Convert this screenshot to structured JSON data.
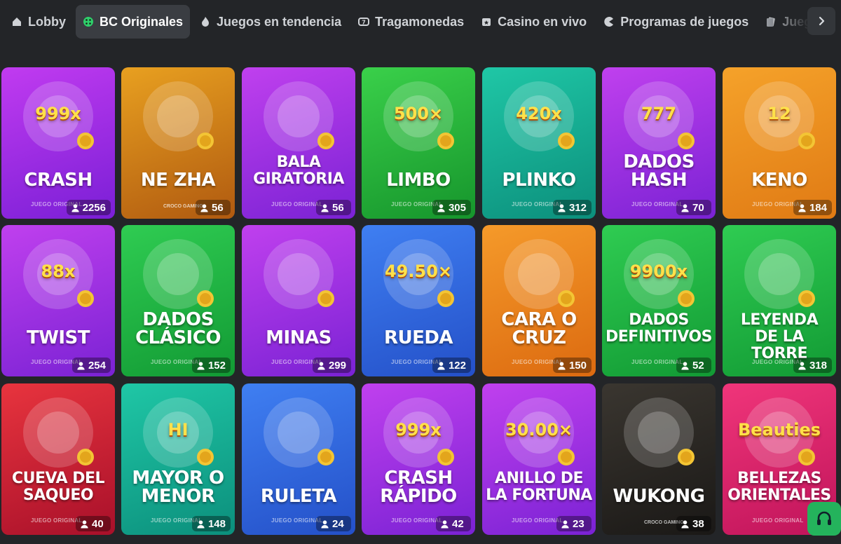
{
  "tabs": [
    {
      "label": "Lobby",
      "icon": "house-icon",
      "active": false
    },
    {
      "label": "BC Originales",
      "icon": "dice-icon",
      "active": true
    },
    {
      "label": "Juegos en tendencia",
      "icon": "flame-icon",
      "active": false
    },
    {
      "label": "Tragamonedas",
      "icon": "slot-icon",
      "active": false
    },
    {
      "label": "Casino en vivo",
      "icon": "live-icon",
      "active": false
    },
    {
      "label": "Programas de juegos",
      "icon": "pacman-icon",
      "active": false
    },
    {
      "label": "Jueg",
      "icon": "cards-icon",
      "active": false
    }
  ],
  "games": [
    {
      "lines": [
        "CRASH"
      ],
      "sub": "JUEGO ORIGINAL",
      "players": "2256",
      "colors": [
        "#c13bf0",
        "#7a1fd6"
      ]
    },
    {
      "lines": [
        "NE ZHA"
      ],
      "sub": "CROCO GAMING",
      "players": "56",
      "colors": [
        "#e8a020",
        "#b05a10"
      ]
    },
    {
      "lines": [
        "BALA",
        "GIRATORIA"
      ],
      "sub": "JUEGO ORIGINAL",
      "players": "56",
      "colors": [
        "#c040ee",
        "#7a22d4"
      ]
    },
    {
      "lines": [
        "LIMBO"
      ],
      "sub": "JUEGO ORIGINAL",
      "players": "305",
      "colors": [
        "#3ad04a",
        "#16952c"
      ]
    },
    {
      "lines": [
        "PLINKO"
      ],
      "sub": "JUEGO ORIGINAL",
      "players": "312",
      "colors": [
        "#1fc7a6",
        "#0c8f7c"
      ]
    },
    {
      "lines": [
        "DADOS",
        "HASH"
      ],
      "sub": "JUEGO ORIGINAL",
      "players": "70",
      "colors": [
        "#c040ee",
        "#7a22d4"
      ]
    },
    {
      "lines": [
        "KENO"
      ],
      "sub": "JUEGO ORIGINAL",
      "players": "184",
      "colors": [
        "#f5a22a",
        "#e07a14"
      ]
    },
    {
      "lines": [
        "TWIST"
      ],
      "sub": "JUEGO ORIGINAL",
      "players": "254",
      "colors": [
        "#c040ee",
        "#7a22d4"
      ]
    },
    {
      "lines": [
        "DADOS",
        "CLÁSICO"
      ],
      "sub": "JUEGO ORIGINAL",
      "players": "152",
      "colors": [
        "#2fcc52",
        "#129a34"
      ]
    },
    {
      "lines": [
        "MINAS"
      ],
      "sub": "JUEGO ORIGINAL",
      "players": "299",
      "colors": [
        "#c040ee",
        "#7a22d4"
      ]
    },
    {
      "lines": [
        "RUEDA"
      ],
      "sub": "JUEGO ORIGINAL",
      "players": "122",
      "colors": [
        "#3f7ff2",
        "#2450c8"
      ]
    },
    {
      "lines": [
        "CARA O",
        "CRUZ"
      ],
      "sub": "JUEGO ORIGINAL",
      "players": "150",
      "colors": [
        "#f59a2a",
        "#dc6a10"
      ]
    },
    {
      "lines": [
        "DADOS",
        "DEFINITIVOS"
      ],
      "sub": "JUEGO ORIGINAL",
      "players": "52",
      "colors": [
        "#2fcc52",
        "#129a34"
      ]
    },
    {
      "lines": [
        "LEYENDA",
        "DE LA TORRE"
      ],
      "sub": "JUEGO ORIGINAL",
      "players": "318",
      "colors": [
        "#2fcc52",
        "#129a34"
      ]
    },
    {
      "lines": [
        "CUEVA DEL",
        "SAQUEO"
      ],
      "sub": "JUEGO ORIGINAL",
      "players": "40",
      "colors": [
        "#e8343e",
        "#a8102a"
      ]
    },
    {
      "lines": [
        "MAYOR O",
        "MENOR"
      ],
      "sub": "JUEGO ORIGINAL",
      "players": "148",
      "colors": [
        "#1fc7a6",
        "#0c8f7c"
      ]
    },
    {
      "lines": [
        "RULETA"
      ],
      "sub": "JUEGO ORIGINAL",
      "players": "24",
      "colors": [
        "#3f7ff2",
        "#2450c8"
      ]
    },
    {
      "lines": [
        "CRASH",
        "RÁPIDO"
      ],
      "sub": "JUEGO ORIGINAL",
      "players": "42",
      "colors": [
        "#c040ee",
        "#7a22d4"
      ]
    },
    {
      "lines": [
        "ANILLO DE",
        "LA FORTUNA"
      ],
      "sub": "JUEGO ORIGINAL",
      "players": "23",
      "colors": [
        "#c040ee",
        "#7a22d4"
      ]
    },
    {
      "lines": [
        "WUKONG"
      ],
      "sub": "CROCO GAMING",
      "players": "38",
      "colors": [
        "#3a3630",
        "#1a1816"
      ]
    },
    {
      "lines": [
        "BELLEZAS",
        "ORIENTALES"
      ],
      "sub": "JUEGO ORIGINAL",
      "players": "",
      "colors": [
        "#f0357a",
        "#c0145a"
      ]
    }
  ],
  "art_labels": [
    "999x",
    "",
    "",
    "500×",
    "420x",
    "777",
    "12",
    "88x",
    "",
    "",
    "49.50×",
    "",
    "9900x",
    "",
    "",
    "HI",
    "",
    "999x",
    "30.00×",
    "",
    "Beauties"
  ]
}
